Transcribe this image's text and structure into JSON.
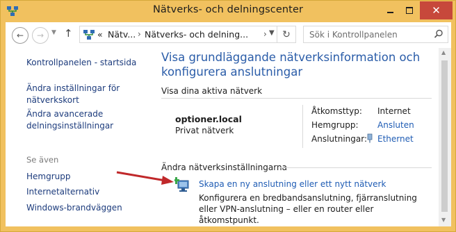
{
  "window": {
    "title": "Nätverks- och delningscenter",
    "close_glyph": "✕"
  },
  "address_bar": {
    "crumbs": [
      "«",
      "Nätv...",
      "Nätverks- och delning..."
    ],
    "search_placeholder": "Sök i Kontrollpanelen"
  },
  "sidebar": {
    "items": [
      {
        "label": "Kontrollpanelen - startsida"
      },
      {
        "label": "Ändra inställningar för\nnätverkskort"
      },
      {
        "label": "Ändra avancerade\ndelningsinställningar"
      }
    ],
    "see_also_label": "Se även",
    "see_also": [
      {
        "label": "Hemgrupp"
      },
      {
        "label": "Internetalternativ"
      },
      {
        "label": "Windows-brandväggen"
      }
    ]
  },
  "main": {
    "heading": "Visa grundläggande nätverksinformation och konfigurera anslutningar",
    "active_networks_label": "Visa dina aktiva nätverk",
    "network": {
      "name": "optioner.local",
      "type": "Privat nätverk",
      "access_type_label": "Åtkomsttyp:",
      "access_type_value": "Internet",
      "homegroup_label": "Hemgrupp:",
      "homegroup_value": "Ansluten",
      "connections_label": "Anslutningar:",
      "connections_value": "Ethernet"
    },
    "change_settings_label": "Ändra nätverksinställningarna",
    "task": {
      "link": "Skapa en ny anslutning eller ett nytt nätverk",
      "description": "Konfigurera en bredbandsanslutning, fjärranslutning eller VPN-anslutning – eller en router eller åtkomstpunkt."
    }
  },
  "colors": {
    "window_frame": "#f1c15f",
    "heading": "#2a5ca8",
    "link": "#1f5cb4",
    "sidebar_link": "#1c3b7c",
    "close_button": "#c7483b",
    "annotation_arrow": "#c0282a"
  }
}
